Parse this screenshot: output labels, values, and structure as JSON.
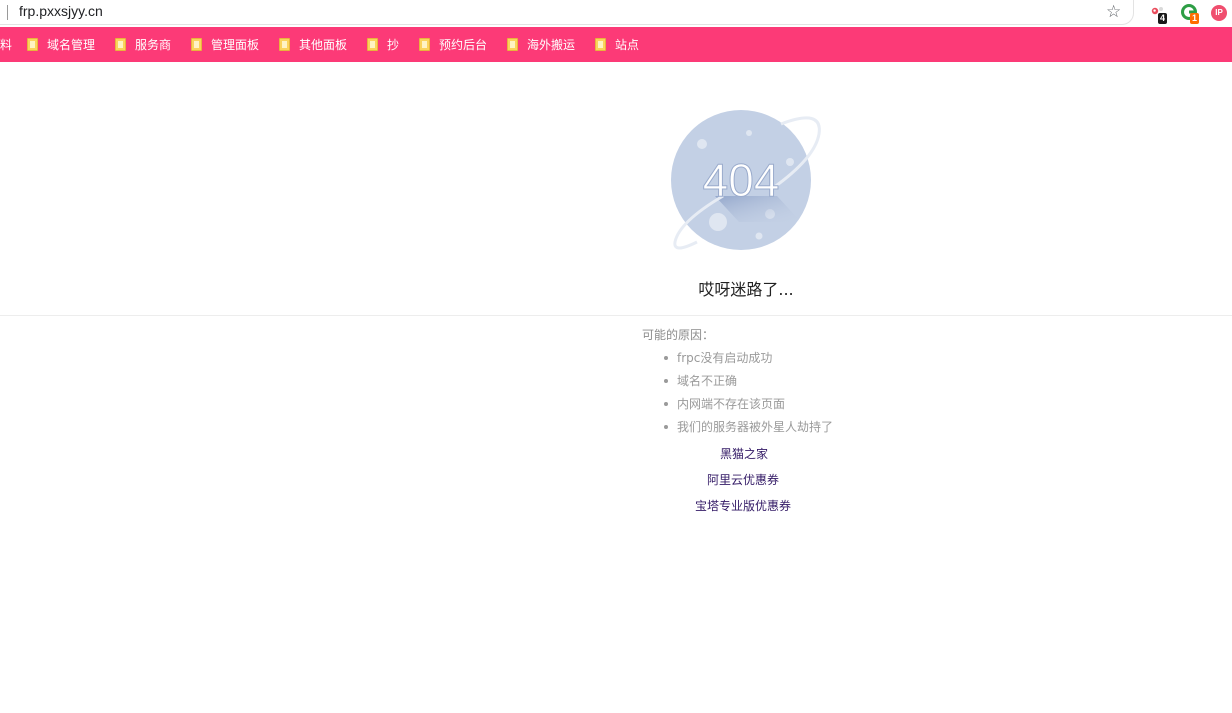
{
  "browser": {
    "url": "frp.pxxsjyy.cn",
    "extensions": [
      {
        "name": "extension-1",
        "badge": "4",
        "badge_color": "#1a1a1a"
      },
      {
        "name": "extension-2",
        "badge": "1",
        "badge_color": "#ff6d00"
      },
      {
        "name": "extension-3",
        "badge": ""
      }
    ],
    "ip_ext_label": "IP"
  },
  "bookmarks": {
    "partial": "料",
    "items": [
      "域名管理",
      "服务商",
      "管理面板",
      "其他面板",
      "抄",
      "预约后台",
      "海外搬运",
      "站点"
    ],
    "bar_color": "#fc3a77"
  },
  "error": {
    "code": "404",
    "headline": "哎呀迷路了...",
    "reasons_title": "可能的原因：",
    "reasons": [
      "frpc没有启动成功",
      "域名不正确",
      "内网端不存在该页面",
      "我们的服务器被外星人劫持了"
    ],
    "links": [
      "黑猫之家",
      "阿里云优惠券",
      "宝塔专业版优惠券"
    ]
  }
}
